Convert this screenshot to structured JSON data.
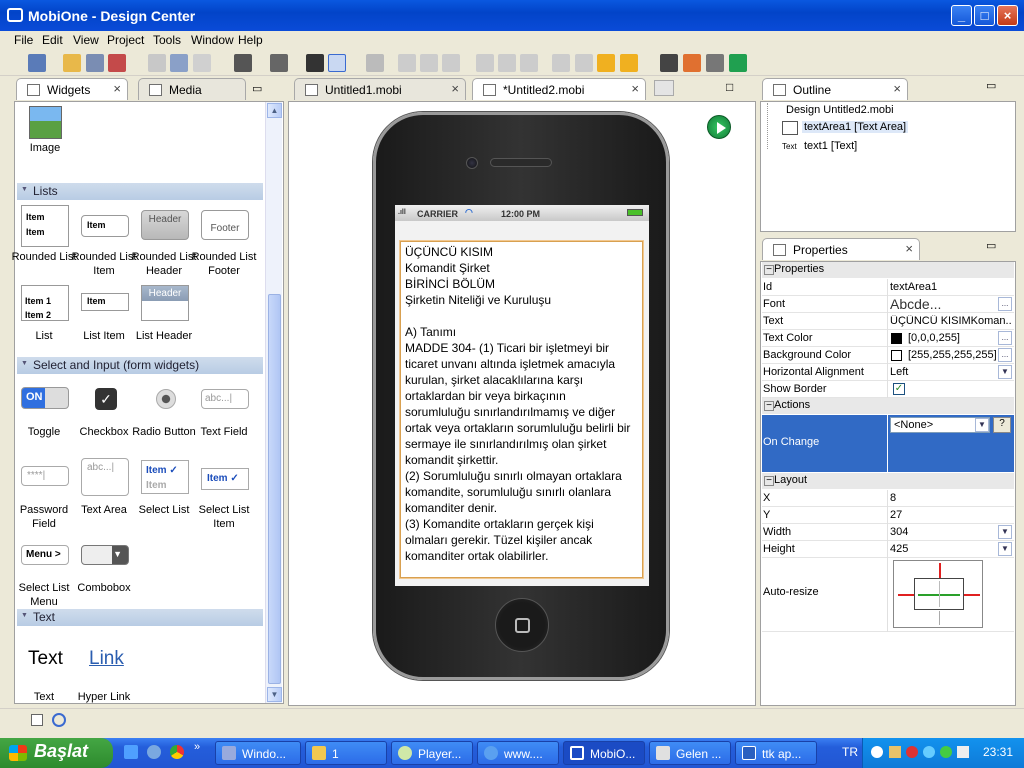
{
  "window": {
    "title": "MobiOne - Design Center"
  },
  "menu": [
    "File",
    "Edit",
    "View",
    "Project",
    "Tools",
    "Window",
    "Help"
  ],
  "left_panel": {
    "tabs": [
      {
        "label": "Widgets"
      },
      {
        "label": "Media"
      }
    ],
    "top_item": {
      "label": "Image"
    },
    "sections": [
      {
        "title": "Lists",
        "widgets": [
          "Rounded List",
          "Rounded List Item",
          "Rounded List Header",
          "Rounded List Footer",
          "List",
          "List Item",
          "List Header"
        ]
      },
      {
        "title": "Select and Input (form widgets)",
        "widgets": [
          "Toggle",
          "Checkbox",
          "Radio Button",
          "Text Field",
          "Password Field",
          "Text Area",
          "Select List",
          "Select List Item",
          "Select List Menu",
          "Combobox"
        ]
      },
      {
        "title": "Text",
        "widgets": [
          "Text",
          "Hyper Link"
        ]
      }
    ],
    "icon_text": {
      "item": "Item",
      "item1": "Item 1",
      "item2": "Item 2",
      "header": "Header",
      "footer": "Footer",
      "on": "ON",
      "abc": "abc...|",
      "pwd": "****|",
      "menu": "Menu",
      "text_sample": "Text",
      "link_sample": "Link"
    }
  },
  "editor": {
    "tabs": [
      {
        "label": "Untitled1.mobi"
      },
      {
        "label": "*Untitled2.mobi"
      }
    ],
    "phone": {
      "carrier": "CARRIER",
      "time": "12:00 PM"
    },
    "textarea": [
      "ÜÇÜNCÜ KISIM",
      "Komandit Şirket",
      "BİRİNCİ BÖLÜM",
      "Şirketin Niteliği ve Kuruluşu",
      "",
      "A) Tanımı",
      "MADDE 304- (1) Ticari bir işletmeyi bir",
      "ticaret unvanı altında işletmek amacıyla",
      "kurulan, şirket alacaklılarına karşı",
      "ortaklardan bir veya birkaçının",
      "sorumluluğu sınırlandırılmamış ve diğer",
      "ortak veya ortakların sorumluluğu belirli bir",
      "sermaye ile sınırlandırılmış olan şirket",
      "komandit şirkettir.",
      "(2) Sorumluluğu sınırlı olmayan ortaklara",
      "komandite, sorumluluğu sınırlı olanlara",
      "komanditer denir.",
      "(3) Komandite ortakların gerçek kişi",
      "olmaları gerekir. Tüzel kişiler ancak",
      "komanditer ortak olabilirler."
    ]
  },
  "outline": {
    "tab": "Outline",
    "items": [
      {
        "label": "Design Untitled2.mobi"
      },
      {
        "label": "textArea1 [Text Area]"
      },
      {
        "icon_text": "Text",
        "label": "text1 [Text]"
      }
    ]
  },
  "properties": {
    "tab": "Properties",
    "groups": {
      "properties": "Properties",
      "actions": "Actions",
      "layout": "Layout"
    },
    "rows": {
      "id": {
        "key": "Id",
        "value": "textArea1"
      },
      "font": {
        "key": "Font",
        "value": "Abcde..."
      },
      "text": {
        "key": "Text",
        "value": "ÜÇÜNCÜ KISIMKoman..."
      },
      "text_color": {
        "key": "Text Color",
        "value": "[0,0,0,255]"
      },
      "bg_color": {
        "key": "Background Color",
        "value": "[255,255,255,255]"
      },
      "halign": {
        "key": "Horizontal Alignment",
        "value": "Left"
      },
      "show_border": {
        "key": "Show Border",
        "checked": true
      },
      "on_change": {
        "key": "On Change",
        "value": "<None>"
      },
      "x": {
        "key": "X",
        "value": "8"
      },
      "y": {
        "key": "Y",
        "value": "27"
      },
      "width": {
        "key": "Width",
        "value": "304"
      },
      "height": {
        "key": "Height",
        "value": "425"
      },
      "autoresize": {
        "key": "Auto-resize"
      }
    }
  },
  "taskbar": {
    "start": "Başlat",
    "items": [
      {
        "label": "Windo..."
      },
      {
        "label": "1"
      },
      {
        "label": "Player..."
      },
      {
        "label": "www...."
      },
      {
        "label": "MobiO..."
      },
      {
        "label": "Gelen ..."
      },
      {
        "label": "ttk ap..."
      }
    ],
    "lang": "TR",
    "clock": "23:31"
  },
  "colors": {
    "accent": "#0a58e0",
    "selection": "#316ac5",
    "play": "#1ea04a"
  }
}
